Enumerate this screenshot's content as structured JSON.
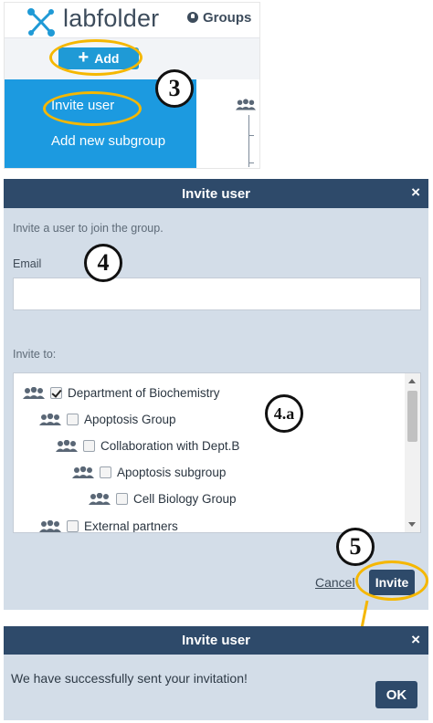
{
  "app": {
    "logo_text": "labfolder",
    "nav_groups": "Groups"
  },
  "toolbar": {
    "add_label": "Add"
  },
  "add_menu": {
    "items": [
      {
        "label": "Invite user"
      },
      {
        "label": "Add new subgroup"
      }
    ]
  },
  "steps": {
    "s3": "3",
    "s4": "4",
    "s4a": "4.a",
    "s5": "5"
  },
  "invite_dialog": {
    "title": "Invite user",
    "close": "×",
    "intro": "Invite a user to join the group.",
    "email_label": "Email",
    "email_value": "",
    "invite_to_label": "Invite to:",
    "groups": [
      {
        "name": "Department of Biochemistry",
        "checked": true,
        "level": 0
      },
      {
        "name": "Apoptosis Group",
        "checked": false,
        "level": 1
      },
      {
        "name": "Collaboration with Dept.B",
        "checked": false,
        "level": 2
      },
      {
        "name": "Apoptosis subgroup",
        "checked": false,
        "level": 3
      },
      {
        "name": "Cell Biology Group",
        "checked": false,
        "level": 4
      },
      {
        "name": "External partners",
        "checked": false,
        "level": 1
      }
    ],
    "cancel_label": "Cancel",
    "invite_label": "Invite"
  },
  "success_dialog": {
    "title": "Invite user",
    "close": "×",
    "message": "We have successfully sent your invitation!",
    "ok_label": "OK"
  },
  "colors": {
    "accent_blue": "#1c9ae0",
    "dialog_header": "#2e4a6a",
    "highlight_ring": "#f5b700"
  }
}
